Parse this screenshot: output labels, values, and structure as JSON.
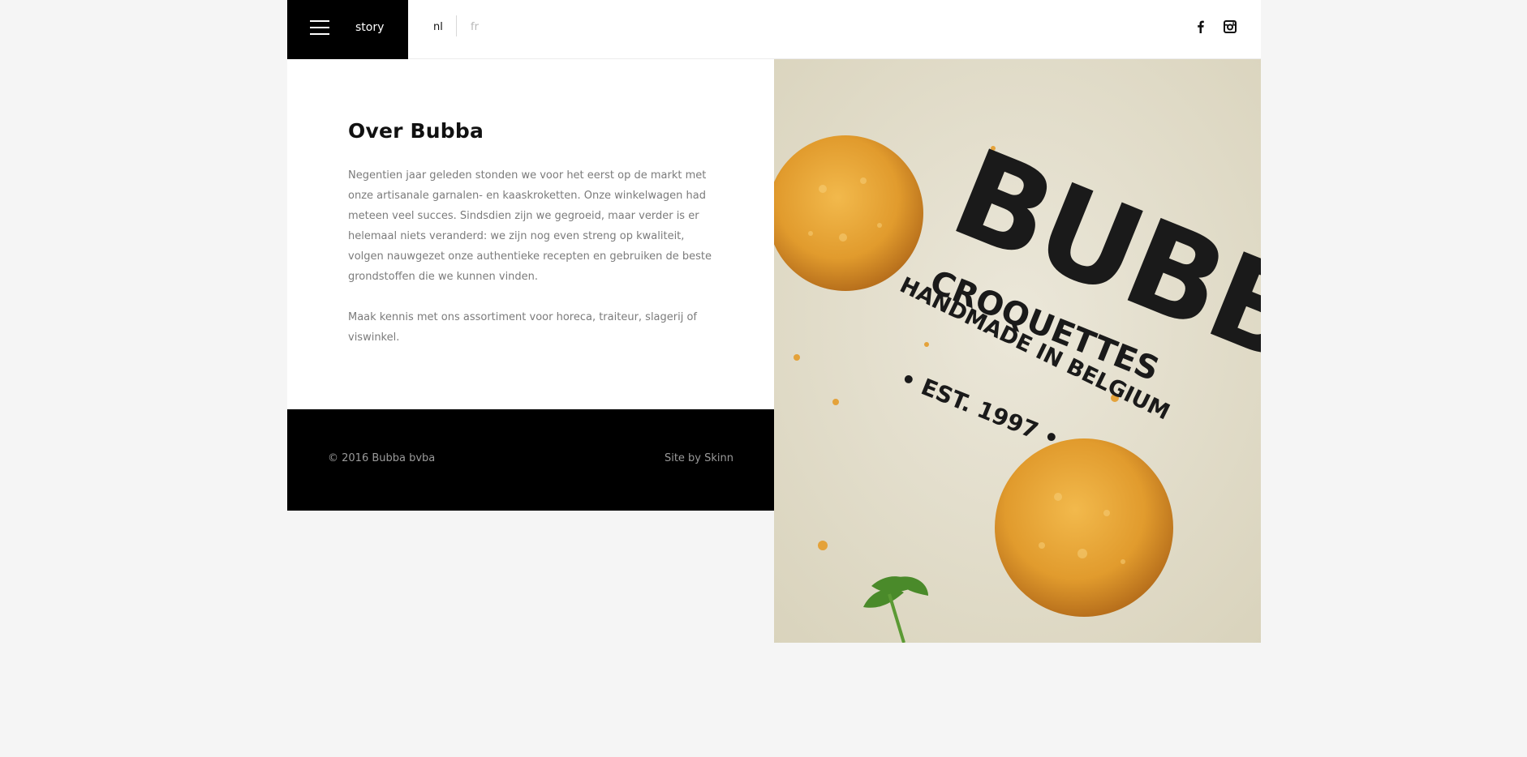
{
  "header": {
    "menu_label": "story",
    "languages": [
      "nl",
      "fr"
    ],
    "active_language": "nl",
    "social": [
      "facebook-icon",
      "instagram-icon"
    ]
  },
  "content": {
    "title": "Over Bubba",
    "paragraph_1": "Negentien jaar geleden stonden we voor het eerst op de markt met onze artisanale garnalen- en kaaskroketten. Onze winkelwagen had meteen veel succes. Sindsdien zijn we gegroeid, maar verder is er helemaal niets veranderd: we zijn nog even streng op kwaliteit, volgen nauwgezet onze authentieke recepten en gebruiken de beste grondstoffen die we kunnen vinden.",
    "paragraph_2": "Maak kennis met ons assortiment voor horeca, traiteur, slagerij of viswinkel."
  },
  "footer": {
    "copyright": "© 2016 Bubba bvba",
    "credit": "Site by Skinn"
  },
  "photo": {
    "brand": "BUBBA",
    "line_1": "CROQUETTES",
    "line_2": "HANDMADE IN BELGIUM",
    "line_3": "EST. 1997"
  },
  "colors": {
    "page_bg": "#f5f5f5",
    "black": "#000000",
    "muted_text": "#7b7b7b",
    "inactive_lang": "#b8b8b8",
    "croquette": "#e3a63a"
  }
}
